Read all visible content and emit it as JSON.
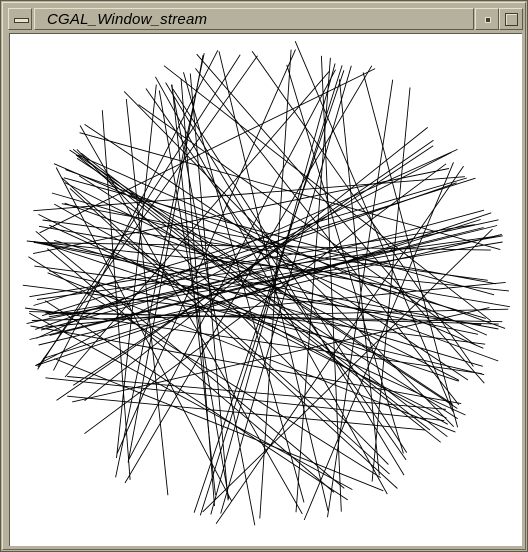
{
  "window": {
    "title": "CGAL_Window_stream"
  },
  "canvas": {
    "background": "#ffffff",
    "line_color": "#000000",
    "segment_count": 120
  },
  "colors": {
    "frame": "#b5b19c",
    "highlight": "#e6e2cc",
    "shadow": "#5e5a4c"
  }
}
